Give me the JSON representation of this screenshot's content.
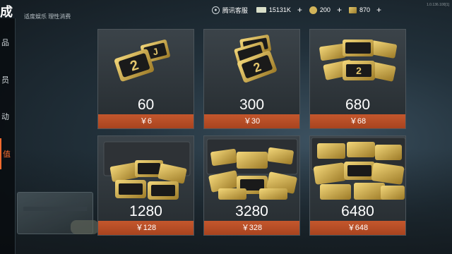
{
  "header": {
    "title": "成",
    "subtitle": "适度娱乐 理性消费"
  },
  "resources": {
    "service_label": "腾讯客服",
    "cash": "15131K",
    "coins": "200",
    "tokens": "870",
    "plus": "+"
  },
  "sidebar": {
    "items": [
      {
        "label": "品"
      },
      {
        "label": "员"
      },
      {
        "label": "动"
      },
      {
        "label": "值"
      }
    ]
  },
  "packs": [
    {
      "amount": "60",
      "price": "￥6"
    },
    {
      "amount": "300",
      "price": "￥30"
    },
    {
      "amount": "680",
      "price": "￥68"
    },
    {
      "amount": "1280",
      "price": "￥128"
    },
    {
      "amount": "3280",
      "price": "￥328"
    },
    {
      "amount": "6480",
      "price": "￥648"
    }
  ],
  "version": "1.0.136.100[1]",
  "colors": {
    "price_bg": "#b94d26",
    "accent": "#f26a2e",
    "gold": "#d8b55a"
  }
}
